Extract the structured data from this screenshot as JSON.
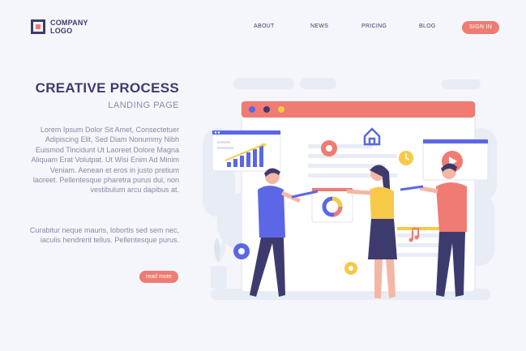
{
  "header": {
    "logo_line1": "COMPANY",
    "logo_line2": "LOGO",
    "nav": [
      "ABOUT",
      "NEWS",
      "PRICING",
      "BLOG"
    ],
    "signin": "SIGN IN"
  },
  "hero": {
    "title": "CREATIVE PROCESS",
    "subtitle": "LANDING PAGE",
    "paragraph1": "Lorem Ipsum Dolor Sit Amet, Consectetuer Adipiscing Elit, Sed Diam Nonummy Nibh Euismod Tincidunt Ut Laoreet Dolore Magna Aliquam Erat Volutpat. Ut Wisi Enim Ad Minim Veniam. Aenean et eros in justo pretium laoreet. Pellentesque pharetra purus dui, non vestibulum arcu dapibus at.",
    "paragraph2": "Curabitur neque mauris, lobortis sed sem nec, iaculis hendrerit tellus. Pellentesque purus.",
    "read_more": "read more"
  },
  "colors": {
    "primary": "#3d3b6e",
    "accent": "#ef7b73",
    "text_muted": "#8a89a3",
    "background": "#f4f6fb",
    "blue": "#5b67e6",
    "yellow": "#f7c948"
  },
  "illustration": {
    "icons": [
      "browser-window-icon",
      "house-icon",
      "gear-icon",
      "clock-icon",
      "play-icon",
      "music-note-icon",
      "bar-chart-icon",
      "donut-chart-icon"
    ]
  }
}
